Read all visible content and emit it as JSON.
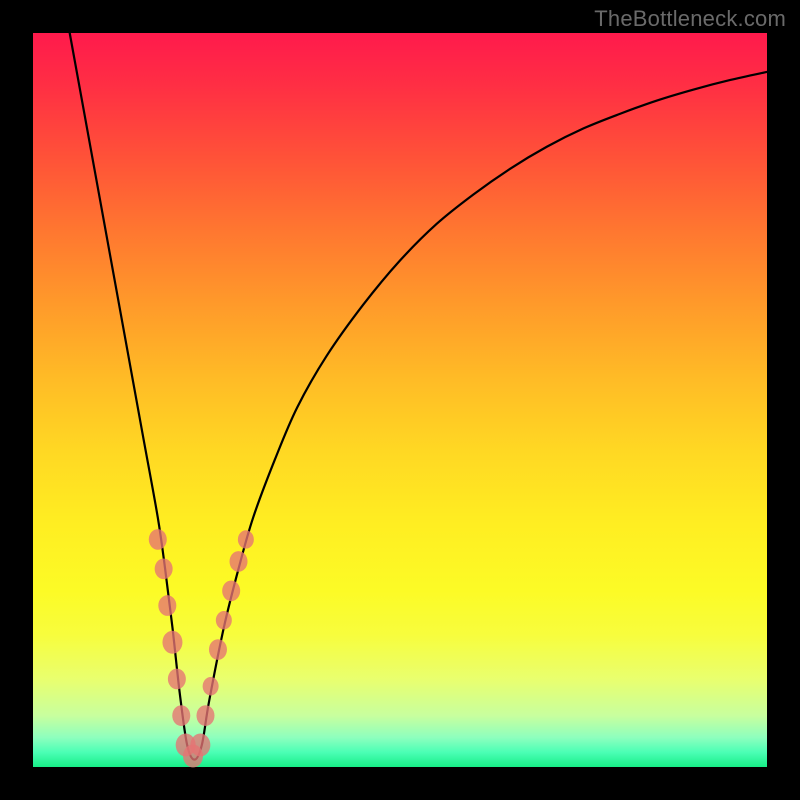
{
  "watermark": "TheBottleneck.com",
  "chart_data": {
    "type": "line",
    "title": "",
    "xlabel": "",
    "ylabel": "",
    "xlim": [
      0,
      100
    ],
    "ylim": [
      0,
      100
    ],
    "curve": {
      "name": "bottleneck-curve",
      "x": [
        5,
        7,
        9,
        11,
        13,
        15,
        17,
        18,
        19,
        20,
        21,
        22,
        23,
        24,
        26,
        28,
        30,
        33,
        36,
        40,
        45,
        50,
        55,
        60,
        65,
        70,
        75,
        80,
        85,
        90,
        95,
        100
      ],
      "y": [
        100,
        89,
        78,
        67,
        56,
        45,
        34,
        27,
        19,
        10,
        3,
        1,
        3,
        9,
        19,
        27,
        34,
        42,
        49,
        56,
        63,
        69,
        74,
        78,
        81.5,
        84.5,
        87,
        89,
        90.8,
        92.3,
        93.6,
        94.7
      ]
    },
    "markers": [
      {
        "x": 17.0,
        "y": 31,
        "r": 9
      },
      {
        "x": 17.8,
        "y": 27,
        "r": 9
      },
      {
        "x": 18.3,
        "y": 22,
        "r": 9
      },
      {
        "x": 19.0,
        "y": 17,
        "r": 10
      },
      {
        "x": 19.6,
        "y": 12,
        "r": 9
      },
      {
        "x": 20.2,
        "y": 7,
        "r": 9
      },
      {
        "x": 20.8,
        "y": 3,
        "r": 10
      },
      {
        "x": 21.8,
        "y": 1.5,
        "r": 10
      },
      {
        "x": 22.8,
        "y": 3,
        "r": 10
      },
      {
        "x": 23.5,
        "y": 7,
        "r": 9
      },
      {
        "x": 24.2,
        "y": 11,
        "r": 8
      },
      {
        "x": 25.2,
        "y": 16,
        "r": 9
      },
      {
        "x": 26.0,
        "y": 20,
        "r": 8
      },
      {
        "x": 27.0,
        "y": 24,
        "r": 9
      },
      {
        "x": 28.0,
        "y": 28,
        "r": 9
      },
      {
        "x": 29.0,
        "y": 31,
        "r": 8
      }
    ]
  }
}
